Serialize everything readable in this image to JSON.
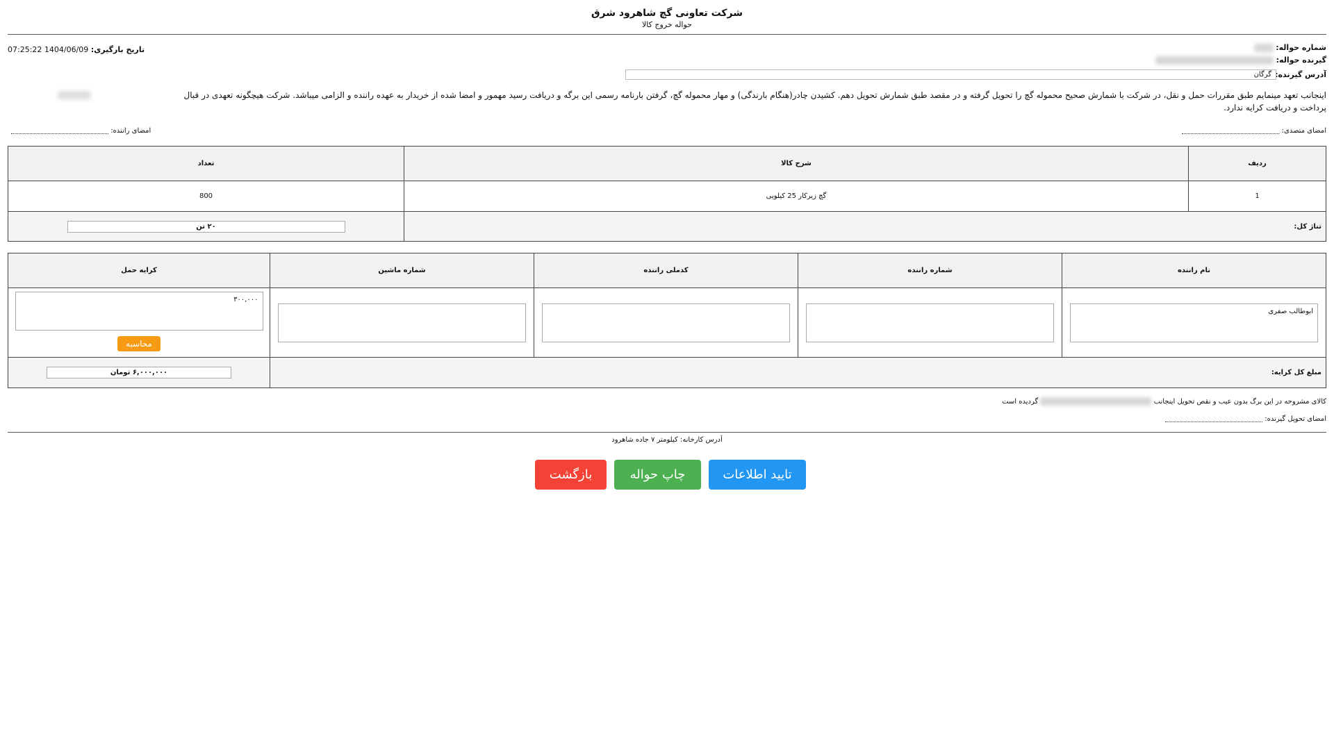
{
  "header": {
    "company_name": "شرکت تعاونی گچ شاهرود شرق",
    "document_title": "حواله خروج کالا"
  },
  "info": {
    "remittance_no_label": "شماره حواله:",
    "recipient_label": "گیرنده حواله:",
    "recipient_address_label": "آدرس گیرنده:",
    "recipient_address_value": "گرگان",
    "load_date_label": "تاریخ بارگیری:",
    "load_date_value": "1404/06/09 07:25:22"
  },
  "statement": {
    "line1": "اینجانب                 تعهد مینمایم طبق مقررات حمل و نقل، در شرکت با شمارش صحیح محموله گچ را تحویل گرفته و در مقصد طبق شمارش تحویل دهم. کشیدن چادر(هنگام بارندگی) و مهار محموله گچ، گرفتن بارنامه رسمی این برگه و دریافت رسید مهمور و امضا شده از خریدار به عهده راننده و الزامی میباشد. شرکت هیچگونه تعهدی در قبال",
    "line2": "پرداخت و دریافت کرایه ندارد."
  },
  "signatures": {
    "officer_label": "امضای متصدی:",
    "driver_label": "امضای راننده:"
  },
  "goods_table": {
    "headers": [
      "ردیف",
      "شرح کالا",
      "تعداد"
    ],
    "rows": [
      {
        "row": "1",
        "description": "گچ زیرکار 25 کیلویی",
        "quantity": "800"
      }
    ],
    "total_tonnage_label": "تناژ کل:",
    "total_tonnage_value": "۲۰ تن"
  },
  "driver_table": {
    "headers": [
      "نام راننده",
      "شماره راننده",
      "کدملی راننده",
      "شماره ماشین",
      "کرایه حمل"
    ],
    "driver_name": "ابوطالب صفری",
    "driver_phone": "",
    "driver_national_id": "",
    "vehicle_no": "",
    "freight_rate": "۳۰۰,۰۰۰",
    "calc_button": "محاسبه",
    "total_freight_label": "مبلغ کل کرایه:",
    "total_freight_value": "۶,۰۰۰,۰۰۰ تومان"
  },
  "delivery": {
    "statement_prefix": "کالای مشروحه در این برگ بدون عیب و نقص تحویل اینجانب",
    "statement_suffix": "گردیده است",
    "receiver_signature_label": "امضای تحویل گیرنده:"
  },
  "footer": {
    "factory_address": "آدرس کارخانه: کیلومتر ۷ جاده شاهرود"
  },
  "actions": {
    "confirm": "تایید اطلاعات",
    "print": "چاپ حواله",
    "back": "بازگشت"
  },
  "colors": {
    "confirm": "#2196f3",
    "print": "#4caf50",
    "back": "#f44336",
    "calc": "#f79a14"
  }
}
